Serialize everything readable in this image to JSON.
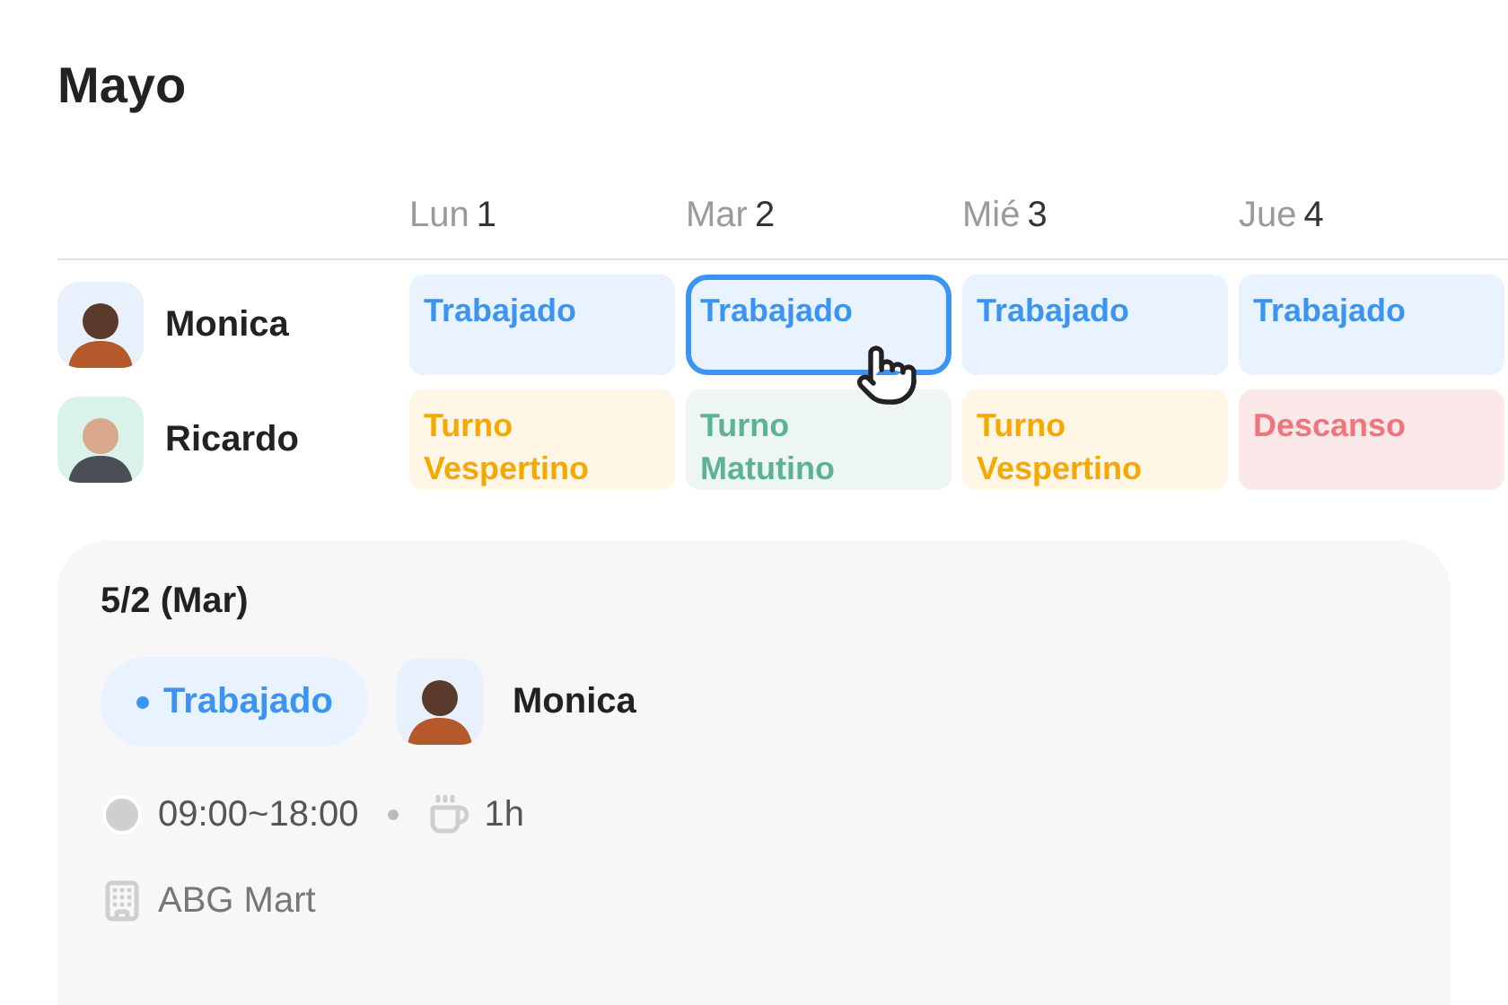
{
  "title": "Mayo",
  "days": [
    {
      "weekday": "Lun",
      "day": "1"
    },
    {
      "weekday": "Mar",
      "day": "2"
    },
    {
      "weekday": "Mié",
      "day": "3"
    },
    {
      "weekday": "Jue",
      "day": "4"
    }
  ],
  "rows": [
    {
      "name": "Monica",
      "cells": [
        {
          "kind": "worked",
          "label": "Trabajado",
          "selected": false
        },
        {
          "kind": "worked",
          "label": "Trabajado",
          "selected": true
        },
        {
          "kind": "worked",
          "label": "Trabajado",
          "selected": false
        },
        {
          "kind": "worked",
          "label": "Trabajado",
          "selected": false
        }
      ]
    },
    {
      "name": "Ricardo",
      "cells": [
        {
          "kind": "evening",
          "label": "Turno Vespertino",
          "selected": false
        },
        {
          "kind": "morning",
          "label": "Turno Matutino",
          "selected": false
        },
        {
          "kind": "evening",
          "label": "Turno Vespertino",
          "selected": false
        },
        {
          "kind": "rest",
          "label": "Descanso",
          "selected": false
        }
      ]
    }
  ],
  "detail": {
    "date": "5/2 (Mar)",
    "status": {
      "kind": "worked",
      "label": "Trabajado"
    },
    "person": "Monica",
    "hours": "09:00~18:00",
    "break": "1h",
    "location": "ABG Mart"
  }
}
